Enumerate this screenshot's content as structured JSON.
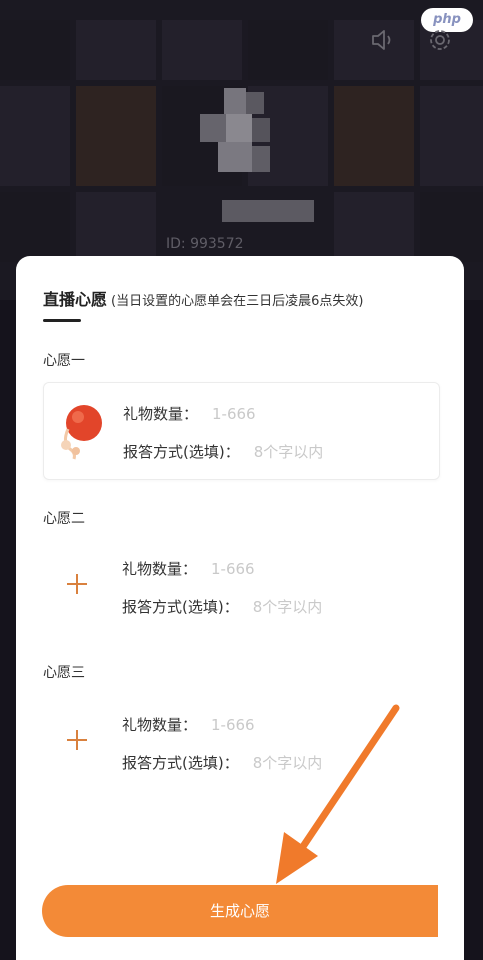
{
  "watermark": "php",
  "header": {
    "user_id_partial": "ID:   993572"
  },
  "sheet": {
    "title": "直播心愿",
    "subtitle": "(当日设置的心愿单会在三日后凌晨6点失效)"
  },
  "wishes": [
    {
      "label": "心愿一",
      "gift_count_label": "礼物数量：",
      "gift_count_placeholder": "1-666",
      "reply_label": "报答方式(选填)：",
      "reply_placeholder": "8个字以内"
    },
    {
      "label": "心愿二",
      "gift_count_label": "礼物数量：",
      "gift_count_placeholder": "1-666",
      "reply_label": "报答方式(选填)：",
      "reply_placeholder": "8个字以内"
    },
    {
      "label": "心愿三",
      "gift_count_label": "礼物数量：",
      "gift_count_placeholder": "1-666",
      "reply_label": "报答方式(选填)：",
      "reply_placeholder": "8个字以内"
    }
  ],
  "generate_button": "生成心愿",
  "colors": {
    "accent": "#f38a37",
    "placeholder": "#c9c9c9"
  }
}
